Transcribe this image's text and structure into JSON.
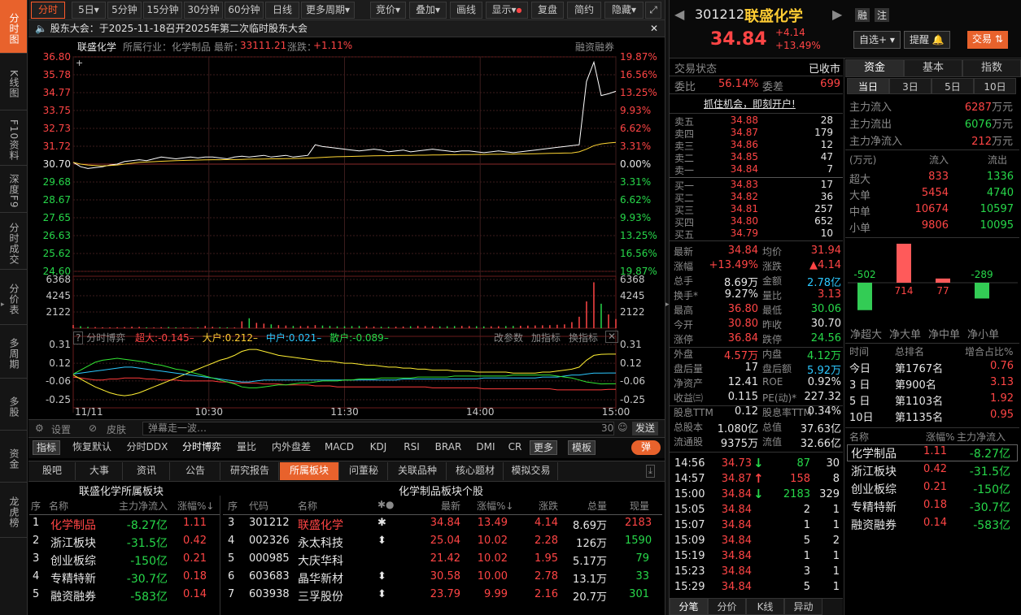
{
  "left_nav": [
    "分时图",
    "K线图",
    "F10资料",
    "深度F9",
    "分时成交",
    "分价表",
    "多周期",
    "多股",
    "资金",
    "龙虎榜"
  ],
  "toolbar": {
    "intraday": "分时",
    "five_day": "5日",
    "m5": "5分钟",
    "m15": "15分钟",
    "m30": "30分钟",
    "m60": "60分钟",
    "daily": "日线",
    "more_period": "更多周期",
    "bid_price": "竞价",
    "overlay": "叠加",
    "draw": "画线",
    "display": "显示",
    "replay": "复盘",
    "simple": "简约",
    "hide": "隐藏"
  },
  "notice": "股东大会：于2025-11-18召开2025年第二次临时股东大会",
  "chart_header": {
    "name": "联盛化学",
    "industry": "所属行业：化学制品",
    "latest_label": "最新：",
    "latest": "33111.21",
    "change_label": "涨跌：",
    "change": "+1.11%",
    "margin": "融资融券"
  },
  "chart_data": {
    "type": "line",
    "left_ticks": [
      "36.80",
      "35.78",
      "34.77",
      "33.75",
      "32.73",
      "31.72",
      "30.70",
      "29.68",
      "28.67",
      "27.65",
      "26.63",
      "25.62",
      "24.60"
    ],
    "right_ticks": [
      "19.87%",
      "16.56%",
      "13.25%",
      "9.93%",
      "6.62%",
      "3.31%",
      "0.00%",
      "3.31%",
      "6.62%",
      "9.93%",
      "13.25%",
      "16.56%",
      "19.87%"
    ],
    "ylim": [
      24.6,
      36.8
    ],
    "prev_close": 30.7,
    "x_ticks": [
      "11/11",
      "10:30",
      "11:30",
      "14:00",
      "15:00"
    ],
    "series": [
      {
        "values": [
          30.8,
          30.55,
          30.45,
          30.5,
          30.55,
          30.65,
          30.7,
          30.85,
          30.9,
          30.95,
          30.9,
          31.0,
          31.1,
          31.05,
          31.0,
          31.05,
          31.1,
          31.05,
          31.1,
          31.1,
          31.05,
          31.0,
          31.1,
          31.15,
          31.1,
          31.15,
          31.2,
          31.1,
          31.15,
          31.2,
          31.1,
          31.15,
          31.2,
          31.8,
          31.7,
          31.65,
          31.6,
          31.55,
          31.5,
          31.45,
          31.5,
          31.55,
          31.5,
          31.4,
          31.45,
          31.5,
          31.4,
          31.45,
          31.5,
          31.55,
          31.5,
          31.45,
          31.4,
          31.45,
          31.45,
          31.4,
          31.35,
          31.4,
          31.45,
          31.4,
          31.35,
          31.4,
          31.45,
          31.5,
          31.55,
          31.6,
          31.65,
          31.7,
          31.75,
          31.8,
          35.4,
          36.5,
          34.6,
          34.7,
          34.84
        ]
      },
      {
        "values": [
          30.8,
          30.7,
          30.65,
          30.62,
          30.6,
          30.62,
          30.65,
          30.7,
          30.75,
          30.8,
          30.82,
          30.84,
          30.86,
          30.88,
          30.9,
          30.91,
          30.92,
          30.93,
          30.94,
          30.95,
          30.95,
          30.96,
          30.96,
          30.97,
          30.98,
          30.98,
          30.99,
          31.0,
          31.0,
          31.01,
          31.02,
          31.03,
          31.04,
          31.06,
          31.08,
          31.1,
          31.12,
          31.13,
          31.14,
          31.15,
          31.16,
          31.17,
          31.18,
          31.18,
          31.19,
          31.2,
          31.2,
          31.21,
          31.21,
          31.22,
          31.22,
          31.23,
          31.23,
          31.24,
          31.24,
          31.25,
          31.25,
          31.26,
          31.26,
          31.27,
          31.27,
          31.28,
          31.28,
          31.29,
          31.3,
          31.31,
          31.32,
          31.33,
          31.34,
          31.4,
          31.55,
          31.75,
          31.85,
          31.9,
          31.94
        ]
      }
    ],
    "volume_ticks": [
      "6368",
      "4245",
      "2122"
    ],
    "volume_max": 6368,
    "volume": [
      420,
      260,
      180,
      150,
      120,
      110,
      130,
      150,
      200,
      180,
      120,
      100,
      140,
      160,
      120,
      90,
      80,
      110,
      300,
      180,
      140,
      120,
      100,
      900,
      1300,
      700,
      600,
      500,
      400,
      350,
      300,
      280,
      300,
      400,
      350,
      300,
      250,
      260,
      280,
      300,
      250,
      220,
      200,
      180,
      200,
      220,
      260,
      300,
      280,
      260,
      240,
      260,
      280,
      300,
      280,
      260,
      240,
      250,
      260,
      280,
      300,
      320,
      340,
      360,
      380,
      400,
      450,
      500,
      800,
      1500,
      3500,
      6000,
      3200,
      1800,
      1200
    ]
  },
  "flow_panel": {
    "title": "分时博弈",
    "super_label": "超大:",
    "super": "-0.145",
    "big_label": "大户:",
    "big": "0.212",
    "mid_label": "中户:",
    "mid": "0.021",
    "small_label": "散户:",
    "small": "-0.089",
    "edit_params": "改参数",
    "add_indicator": "加指标",
    "switch_indicator": "换指标",
    "ticks": [
      "0.31",
      "0.12",
      "-0.06",
      "-0.25"
    ]
  },
  "flow_data": {
    "ylim": [
      -0.3,
      0.36
    ],
    "series": [
      {
        "name": "超大",
        "color": "#ff3b3b",
        "values": [
          -0.02,
          -0.03,
          -0.04,
          -0.05,
          -0.05,
          -0.04,
          -0.04,
          -0.03,
          -0.03,
          -0.03,
          -0.04,
          -0.04,
          -0.05,
          -0.05,
          -0.05,
          -0.06,
          -0.06,
          -0.06,
          -0.06,
          -0.06,
          -0.07,
          -0.07,
          -0.08,
          -0.08,
          -0.08,
          -0.08,
          -0.09,
          -0.09,
          -0.09,
          -0.1,
          -0.1,
          -0.1,
          -0.1,
          -0.11,
          -0.11,
          -0.11,
          -0.12,
          -0.12,
          -0.12,
          -0.12,
          -0.12,
          -0.12,
          -0.12,
          -0.12,
          -0.12,
          -0.12,
          -0.12,
          -0.12,
          -0.12,
          -0.13,
          -0.13,
          -0.13,
          -0.13,
          -0.13,
          -0.13,
          -0.13,
          -0.14,
          -0.14,
          -0.14,
          -0.14,
          -0.14,
          -0.14,
          -0.14,
          -0.14,
          -0.14,
          -0.14,
          -0.15,
          -0.15,
          -0.15,
          -0.15,
          -0.15,
          -0.15,
          -0.15,
          -0.145,
          -0.145
        ]
      },
      {
        "name": "大户",
        "color": "#ffef33",
        "values": [
          0.0,
          -0.04,
          -0.08,
          -0.12,
          -0.15,
          -0.18,
          -0.2,
          -0.21,
          -0.2,
          -0.18,
          -0.15,
          -0.12,
          -0.09,
          -0.06,
          -0.03,
          0.0,
          0.03,
          0.06,
          0.09,
          0.12,
          0.15,
          0.17,
          0.2,
          0.24,
          0.26,
          0.26,
          0.24,
          0.22,
          0.2,
          0.19,
          0.18,
          0.17,
          0.16,
          0.15,
          0.14,
          0.14,
          0.13,
          0.12,
          0.12,
          0.11,
          0.1,
          0.1,
          0.09,
          0.08,
          0.08,
          0.07,
          0.07,
          0.06,
          0.06,
          0.05,
          0.05,
          0.05,
          0.04,
          0.04,
          0.04,
          0.03,
          0.03,
          0.03,
          0.03,
          0.03,
          0.02,
          0.02,
          0.02,
          0.02,
          0.03,
          0.03,
          0.04,
          0.05,
          0.06,
          0.08,
          0.15,
          0.2,
          0.21,
          0.212,
          0.212
        ]
      },
      {
        "name": "中户",
        "color": "#2cc8ff",
        "values": [
          0.01,
          0.02,
          0.03,
          0.04,
          0.05,
          0.06,
          0.07,
          0.08,
          0.08,
          0.07,
          0.06,
          0.05,
          0.04,
          0.03,
          0.02,
          0.01,
          0.0,
          -0.01,
          -0.02,
          -0.03,
          -0.04,
          -0.05,
          -0.06,
          -0.07,
          -0.07,
          -0.06,
          -0.05,
          -0.05,
          -0.05,
          -0.05,
          -0.05,
          -0.05,
          -0.05,
          -0.05,
          -0.05,
          -0.05,
          -0.05,
          -0.05,
          -0.05,
          -0.05,
          -0.05,
          -0.05,
          -0.05,
          -0.05,
          -0.05,
          -0.04,
          -0.04,
          -0.04,
          -0.04,
          -0.04,
          -0.04,
          -0.04,
          -0.04,
          -0.04,
          -0.04,
          -0.04,
          -0.03,
          -0.03,
          -0.03,
          -0.03,
          -0.03,
          -0.03,
          -0.03,
          -0.03,
          -0.02,
          -0.02,
          -0.02,
          -0.01,
          0.0,
          0.0,
          0.01,
          0.02,
          0.02,
          0.021,
          0.021
        ]
      },
      {
        "name": "散户",
        "color": "#33e633",
        "values": [
          0.01,
          0.05,
          0.09,
          0.13,
          0.15,
          0.16,
          0.17,
          0.16,
          0.15,
          0.14,
          0.13,
          0.11,
          0.1,
          0.08,
          0.06,
          0.05,
          0.03,
          0.01,
          -0.01,
          -0.03,
          -0.05,
          -0.07,
          -0.09,
          -0.12,
          -0.13,
          -0.13,
          -0.12,
          -0.11,
          -0.1,
          -0.1,
          -0.09,
          -0.08,
          -0.08,
          -0.07,
          -0.06,
          -0.06,
          -0.06,
          -0.05,
          -0.05,
          -0.04,
          -0.04,
          -0.04,
          -0.03,
          -0.03,
          -0.03,
          -0.03,
          -0.03,
          -0.02,
          -0.02,
          -0.02,
          -0.02,
          -0.02,
          -0.01,
          -0.01,
          -0.01,
          -0.01,
          -0.01,
          -0.01,
          -0.01,
          -0.01,
          0.0,
          0.0,
          0.0,
          0.0,
          0.0,
          0.0,
          -0.01,
          -0.02,
          -0.03,
          -0.05,
          -0.07,
          -0.08,
          -0.09,
          -0.089,
          -0.089
        ]
      }
    ]
  },
  "bottom_bar": {
    "settings": "设置",
    "skin": "皮肤",
    "danmu_placeholder": "弹幕走一波…",
    "danmu_count": "30",
    "send": "发送"
  },
  "indicator_bar": [
    "指标",
    "恢复默认",
    "分时DDX",
    "分时博弈",
    "量比",
    "内外盘差",
    "MACD",
    "KDJ",
    "RSI",
    "BRAR",
    "DMI",
    "CR",
    "更多",
    "模板",
    "弹"
  ],
  "info_tabs": [
    "股吧",
    "大事",
    "资讯",
    "公告",
    "研究报告",
    "所属板块",
    "问董秘",
    "关联品种",
    "核心题材",
    "模拟交易"
  ],
  "sector_left": {
    "title": "联盛化学所属板块",
    "headers": [
      "序",
      "名称",
      "主力净流入",
      "涨幅%↓"
    ],
    "rows": [
      [
        "1",
        "化学制品",
        "-8.27亿",
        "1.11"
      ],
      [
        "2",
        "浙江板块",
        "-31.5亿",
        "0.42"
      ],
      [
        "3",
        "创业板综",
        "-150亿",
        "0.21"
      ],
      [
        "4",
        "专精特新",
        "-30.7亿",
        "0.18"
      ],
      [
        "5",
        "融资融券",
        "-583亿",
        "0.14"
      ]
    ]
  },
  "sector_right": {
    "title": "化学制品板块个股",
    "headers": [
      "序",
      "代码",
      "名称",
      "✱●",
      "最新",
      "涨幅%↓",
      "涨跌",
      "总量",
      "现量"
    ],
    "rows": [
      [
        "3",
        "301212",
        "联盛化学",
        "✱",
        "34.84",
        "13.49",
        "4.14",
        "8.69万",
        "2183"
      ],
      [
        "4",
        "002326",
        "永太科技",
        "⬍",
        "25.04",
        "10.02",
        "2.28",
        "126万",
        "1590"
      ],
      [
        "5",
        "000985",
        "大庆华科",
        "",
        "21.42",
        "10.02",
        "1.95",
        "5.17万",
        "79"
      ],
      [
        "6",
        "603683",
        "晶华新材",
        "⬍",
        "30.58",
        "10.00",
        "2.78",
        "13.1万",
        "33"
      ],
      [
        "7",
        "603938",
        "三孚股份",
        "⬍",
        "23.79",
        "9.99",
        "2.16",
        "20.7万",
        "301"
      ]
    ]
  },
  "stock": {
    "code": "301212",
    "name": "联盛化学",
    "price": "34.84",
    "chg": "+4.14",
    "pct": "+13.49%",
    "margin": "融",
    "hk": "注",
    "watch": "自选+",
    "alert": "提醒",
    "trade": "交易"
  },
  "status": {
    "label": "交易状态",
    "value": "已收市",
    "wb_label": "委比",
    "wb": "56.14%",
    "wc_label": "委差",
    "wc": "699",
    "promo": "抓住机会，即刻开户!"
  },
  "asks": [
    [
      "卖五",
      "34.88",
      "28"
    ],
    [
      "卖四",
      "34.87",
      "179"
    ],
    [
      "卖三",
      "34.86",
      "12"
    ],
    [
      "卖二",
      "34.85",
      "47"
    ],
    [
      "卖一",
      "34.84",
      "7"
    ]
  ],
  "bids": [
    [
      "买一",
      "34.83",
      "17"
    ],
    [
      "买二",
      "34.82",
      "36"
    ],
    [
      "买三",
      "34.81",
      "257"
    ],
    [
      "买四",
      "34.80",
      "652"
    ],
    [
      "买五",
      "34.79",
      "10"
    ]
  ],
  "quote": [
    [
      "最新",
      "34.84",
      "均价",
      "31.94"
    ],
    [
      "涨幅",
      "+13.49%",
      "涨跌",
      "▲4.14"
    ],
    [
      "总手",
      "8.69万",
      "金额",
      "2.78亿"
    ],
    [
      "换手*",
      "9.27%",
      "量比",
      "3.13"
    ],
    [
      "最高",
      "36.80",
      "最低",
      "30.06"
    ],
    [
      "今开",
      "30.80",
      "昨收",
      "30.70"
    ],
    [
      "涨停",
      "36.84",
      "跌停",
      "24.56"
    ],
    [
      "外盘",
      "4.57万",
      "内盘",
      "4.12万"
    ],
    [
      "盘后量",
      "17",
      "盘后额",
      "5.92万"
    ],
    [
      "净资产",
      "12.41",
      "ROE",
      "0.92%"
    ],
    [
      "收益㈢",
      "0.115",
      "PE(动)*",
      "227.32"
    ],
    [
      "股息TTM",
      "0.12",
      "股息率TTM",
      "0.34%"
    ],
    [
      "总股本",
      "1.080亿",
      "总值",
      "37.63亿"
    ],
    [
      "流通股",
      "9375万",
      "流值",
      "32.66亿"
    ]
  ],
  "ticks": [
    [
      "14:56",
      "34.73",
      "↓",
      "87",
      "30"
    ],
    [
      "14:57",
      "34.87",
      "↑",
      "158",
      "8"
    ],
    [
      "15:00",
      "34.84",
      "↓",
      "2183",
      "329"
    ],
    [
      "15:05",
      "34.84",
      "",
      "2",
      "1"
    ],
    [
      "15:07",
      "34.84",
      "",
      "1",
      "1"
    ],
    [
      "15:09",
      "34.84",
      "",
      "5",
      "2"
    ],
    [
      "15:19",
      "34.84",
      "",
      "1",
      "1"
    ],
    [
      "15:23",
      "34.84",
      "",
      "3",
      "1"
    ],
    [
      "15:29",
      "34.84",
      "",
      "5",
      "1"
    ]
  ],
  "tick_tabs": [
    "分笔",
    "分价",
    "K线",
    "异动"
  ],
  "fund": {
    "tabs": [
      "资金",
      "基本",
      "指数"
    ],
    "periods": [
      "当日",
      "3日",
      "5日",
      "10日"
    ],
    "main_in_label": "主力流入",
    "main_in": "6287",
    "main_out_label": "主力流出",
    "main_out": "6076",
    "main_net_label": "主力净流入",
    "main_net": "212",
    "unit": "万元",
    "grid_headers": [
      "(万元)",
      "流入",
      "流出"
    ],
    "grid": [
      [
        "超大",
        "833",
        "1336"
      ],
      [
        "大单",
        "5454",
        "4740"
      ],
      [
        "中单",
        "10674",
        "10597"
      ],
      [
        "小单",
        "9806",
        "10095"
      ]
    ],
    "bars": [
      {
        "label": "净超大",
        "value": -502
      },
      {
        "label": "净大单",
        "value": 714
      },
      {
        "label": "净中单",
        "value": 77
      },
      {
        "label": "净小单",
        "value": -289
      }
    ],
    "rank_headers": [
      "时间",
      "总排名",
      "增合占比%"
    ],
    "ranks": [
      [
        "今日",
        "第1767名",
        "0.76"
      ],
      [
        "3 日",
        "第900名",
        "3.13"
      ],
      [
        "5 日",
        "第1103名",
        "1.92"
      ],
      [
        "10日",
        "第1135名",
        "0.95"
      ]
    ],
    "sector_headers": [
      "名称",
      "涨幅%",
      "主力净流入"
    ],
    "sectors": [
      [
        "化学制品",
        "1.11",
        "-8.27亿"
      ],
      [
        "浙江板块",
        "0.42",
        "-31.5亿"
      ],
      [
        "创业板综",
        "0.21",
        "-150亿"
      ],
      [
        "专精特新",
        "0.18",
        "-30.7亿"
      ],
      [
        "融资融券",
        "0.14",
        "-583亿"
      ]
    ]
  }
}
